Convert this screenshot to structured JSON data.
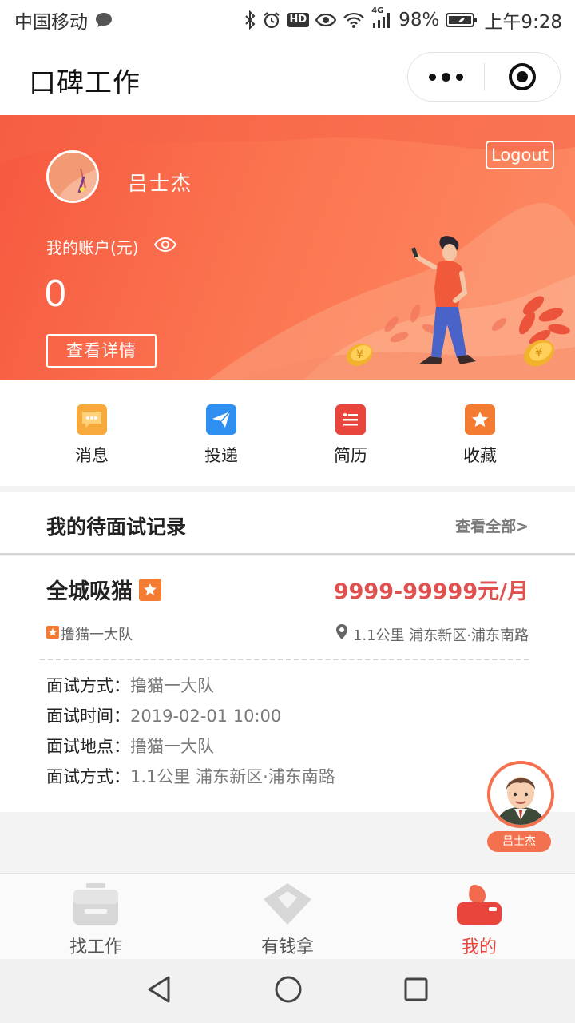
{
  "status_bar": {
    "carrier": "中国移动",
    "network": "4G",
    "battery": "98%",
    "time": "上午9:28",
    "hd_badge": "HD"
  },
  "title_bar": {
    "title": "口碑工作"
  },
  "profile": {
    "name": "吕士杰",
    "logout_label": "Logout",
    "account_label": "我的账户(元)",
    "balance": "0",
    "detail_button": "查看详情"
  },
  "quick_menu": [
    {
      "label": "消息",
      "icon": "message-icon",
      "color": "#f7a93b"
    },
    {
      "label": "投递",
      "icon": "send-icon",
      "color": "#2f8ff0"
    },
    {
      "label": "简历",
      "icon": "resume-icon",
      "color": "#e8453c"
    },
    {
      "label": "收藏",
      "icon": "favorite-icon",
      "color": "#f47b32"
    }
  ],
  "interviews": {
    "section_title": "我的待面试记录",
    "view_all": "查看全部>",
    "records": [
      {
        "job_title": "全城吸猫",
        "salary": "9999-99999元/月",
        "company": "撸猫一大队",
        "location": "1.1公里 浦东新区·浦东南路",
        "details": [
          {
            "label": "面试方式：",
            "value": "撸猫一大队"
          },
          {
            "label": "面试时间：",
            "value": "2019-02-01 10:00"
          },
          {
            "label": "面试地点：",
            "value": "撸猫一大队"
          },
          {
            "label": "面试方式：",
            "value": "1.1公里 浦东新区·浦东南路"
          }
        ]
      }
    ]
  },
  "floating_user": {
    "name": "吕士杰"
  },
  "tab_bar": [
    {
      "label": "找工作",
      "icon": "briefcase-icon",
      "active": false
    },
    {
      "label": "有钱拿",
      "icon": "diamond-icon",
      "active": false
    },
    {
      "label": "我的",
      "icon": "profile-icon",
      "active": true
    }
  ],
  "colors": {
    "accent": "#f4714f",
    "salary_red": "#e0504f",
    "active_tab": "#e8453c",
    "hero_start": "#f6583f",
    "hero_end": "#fd8b64"
  }
}
